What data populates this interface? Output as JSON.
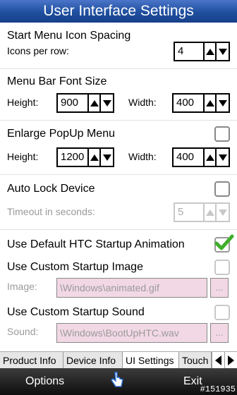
{
  "title": "User Interface Settings",
  "start_menu": {
    "heading": "Start Menu Icon Spacing",
    "icons_per_row_label": "Icons per row:",
    "icons_per_row_value": "4"
  },
  "menu_bar_font": {
    "heading": "Menu Bar Font Size",
    "height_label": "Height:",
    "height_value": "900",
    "width_label": "Width:",
    "width_value": "400"
  },
  "popup_menu": {
    "heading": "Enlarge PopUp Menu",
    "checked": false,
    "height_label": "Height:",
    "height_value": "1200",
    "width_label": "Width:",
    "width_value": "400"
  },
  "auto_lock": {
    "heading": "Auto Lock Device",
    "checked": false,
    "timeout_label": "Timeout in seconds:",
    "timeout_value": "5"
  },
  "startup_animation": {
    "label": "Use Default HTC Startup Animation",
    "checked": true
  },
  "custom_image": {
    "label": "Use Custom Startup Image",
    "checked": false,
    "field_label": "Image:",
    "path": "\\Windows\\animated.gif",
    "browse": "..."
  },
  "custom_sound": {
    "label": "Use Custom Startup Sound",
    "checked": false,
    "field_label": "Sound:",
    "path": "\\Windows\\BootUpHTC.wav",
    "browse": "..."
  },
  "tabs": [
    "Product Info",
    "Device Info",
    "UI Settings",
    "Touch"
  ],
  "active_tab": "UI Settings",
  "softkeys": {
    "left": "Options",
    "right": "Exit"
  },
  "corner_tag": "#151935",
  "colors": {
    "title_bar": "#1f4f9e",
    "check_green": "#3fae2a",
    "field_bg": "#f2d8e4"
  }
}
